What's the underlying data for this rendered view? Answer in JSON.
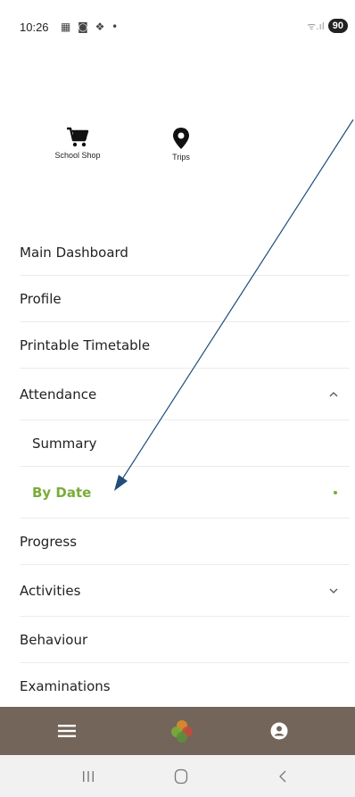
{
  "status_bar": {
    "time": "10:26",
    "notification_icons": "▦ ◙ ❖ •",
    "signal_text": "ᯤ.ıl",
    "battery": "90"
  },
  "quick_links": [
    {
      "label": "School Shop",
      "icon": "cart-icon"
    },
    {
      "label": "Trips",
      "icon": "location-pin-icon"
    }
  ],
  "menu": {
    "items": [
      {
        "label": "Main Dashboard"
      },
      {
        "label": "Profile"
      },
      {
        "label": "Printable Timetable"
      },
      {
        "label": "Attendance",
        "expanded": true
      },
      {
        "label": "Summary",
        "sub": true
      },
      {
        "label": "By Date",
        "sub": true,
        "active": true
      },
      {
        "label": "Progress"
      },
      {
        "label": "Activities",
        "expanded": false
      },
      {
        "label": "Behaviour"
      },
      {
        "label": "Examinations"
      }
    ]
  },
  "app_bar": {
    "items": [
      "hamburger-menu-icon",
      "school-logo-icon",
      "account-icon"
    ],
    "background": "#73655a"
  },
  "system_nav": [
    "recent-apps-icon",
    "home-icon",
    "back-icon"
  ],
  "colors": {
    "accent": "#7aac3a",
    "annotation_arrow": "#1f4e79"
  }
}
